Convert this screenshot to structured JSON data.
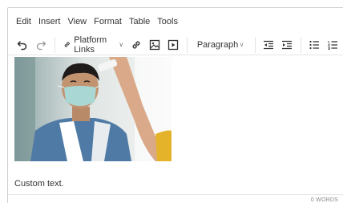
{
  "menubar": {
    "items": [
      "Edit",
      "Insert",
      "View",
      "Format",
      "Table",
      "Tools"
    ]
  },
  "toolbar": {
    "undo_icon": "undo-icon",
    "redo_icon": "redo-icon",
    "platform_links_label": "Platform Links",
    "link_icon": "link-icon",
    "image_icon": "image-icon",
    "media_icon": "media-icon",
    "block_format_value": "Paragraph",
    "outdent_icon": "outdent-icon",
    "indent_icon": "indent-icon",
    "bullet_list_icon": "bullet-list-icon",
    "numbered_list_icon": "numbered-list-icon"
  },
  "content": {
    "body_text": "Custom text."
  },
  "status": {
    "word_count": "0 WORDS"
  },
  "colors": {
    "border": "#cfcfcf",
    "text": "#333333",
    "muted": "#888888"
  }
}
